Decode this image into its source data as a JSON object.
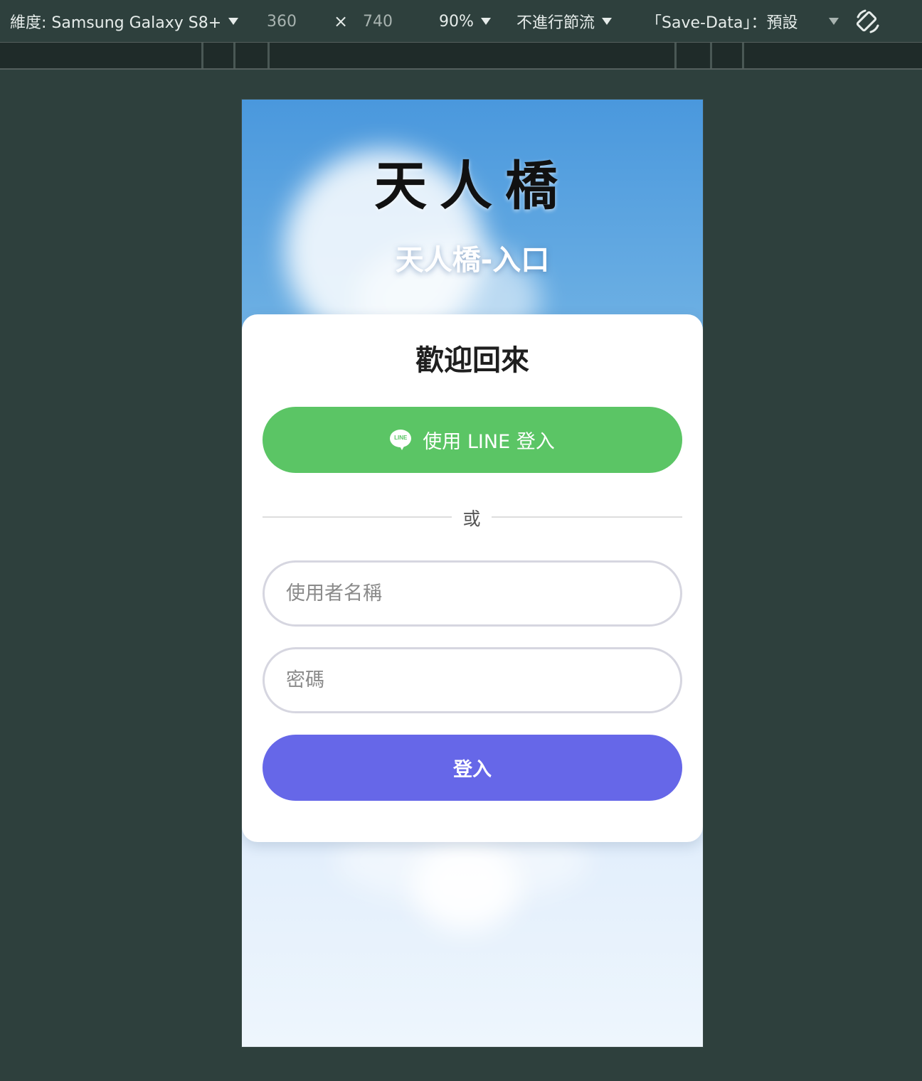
{
  "devtools": {
    "dimensions_label": "維度: Samsung Galaxy S8+",
    "width": "360",
    "times": "×",
    "height": "740",
    "zoom": "90%",
    "throttling": "不進行節流",
    "save_data": "「Save-Data」：預設",
    "icons": {
      "dimensions_caret": "chevron-down-icon",
      "rotate": "rotate-device-icon"
    }
  },
  "page": {
    "logo_text": "天人橋",
    "subtitle": "天人橋-入口",
    "card": {
      "title": "歡迎回來",
      "line_button": {
        "label": "使用 LINE 登入",
        "icon_text": "LINE",
        "color": "#5bc565"
      },
      "divider_text": "或",
      "username": {
        "placeholder": "使用者名稱",
        "value": ""
      },
      "password": {
        "placeholder": "密碼",
        "value": ""
      },
      "login_button": {
        "label": "登入",
        "color": "#6667e8"
      }
    }
  }
}
